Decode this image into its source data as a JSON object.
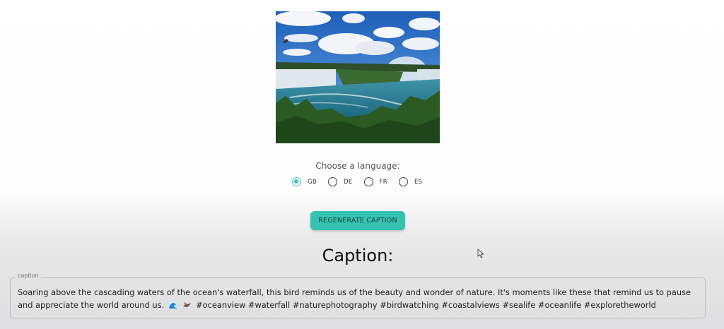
{
  "image": {
    "alt": "Waterfall landscape photo"
  },
  "language": {
    "prompt": "Choose a language:",
    "options": [
      {
        "label": "GB",
        "selected": true
      },
      {
        "label": "DE",
        "selected": false
      },
      {
        "label": "FR",
        "selected": false
      },
      {
        "label": "ES",
        "selected": false
      }
    ],
    "accent_color": "#3cc6b4"
  },
  "regenerate_button": {
    "label": "REGENERATE CAPTION",
    "color": "#34c3b0"
  },
  "caption_section": {
    "heading": "Caption:",
    "field_label": "caption",
    "text": "Soaring above the cascading waters of the ocean's waterfall, this bird reminds us of the beauty and wonder of nature. It's moments like these that remind us to pause and appreciate the world around us.",
    "emojis": [
      "wave-emoji",
      "bird-emoji"
    ],
    "hashtags": "#oceanview #waterfall #naturephotography #birdwatching #coastalviews #sealife #oceanlife #exploretheworld"
  }
}
